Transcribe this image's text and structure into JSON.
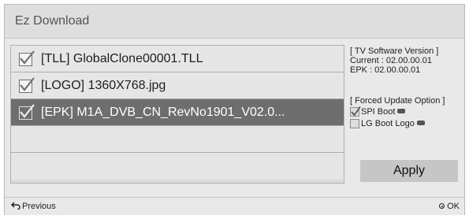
{
  "window": {
    "title": "Ez Download"
  },
  "files": [
    {
      "name": "[TLL] GlobalClone00001.TLL",
      "checked": true,
      "selected": false
    },
    {
      "name": "[LOGO] 1360X768.jpg",
      "checked": true,
      "selected": false
    },
    {
      "name": "[EPK] M1A_DVB_CN_RevNo1901_V02.0...",
      "checked": true,
      "selected": true
    }
  ],
  "software_version": {
    "header": "[ TV Software Version ]",
    "current": "Current : 02.00.00.01",
    "epk": "EPK : 02.00.00.01"
  },
  "forced_update": {
    "header": "[ Forced Update Option ]",
    "options": [
      {
        "label": "SPI Boot",
        "checked": true
      },
      {
        "label": "LG Boot Logo",
        "checked": false
      }
    ]
  },
  "apply_label": "Apply",
  "footer": {
    "previous_label": "Previous",
    "ok_label": "OK"
  },
  "colors": {
    "selected_row": "#6e6e6e",
    "button": "#c6c6c6",
    "panel": "#e9e9e9"
  }
}
